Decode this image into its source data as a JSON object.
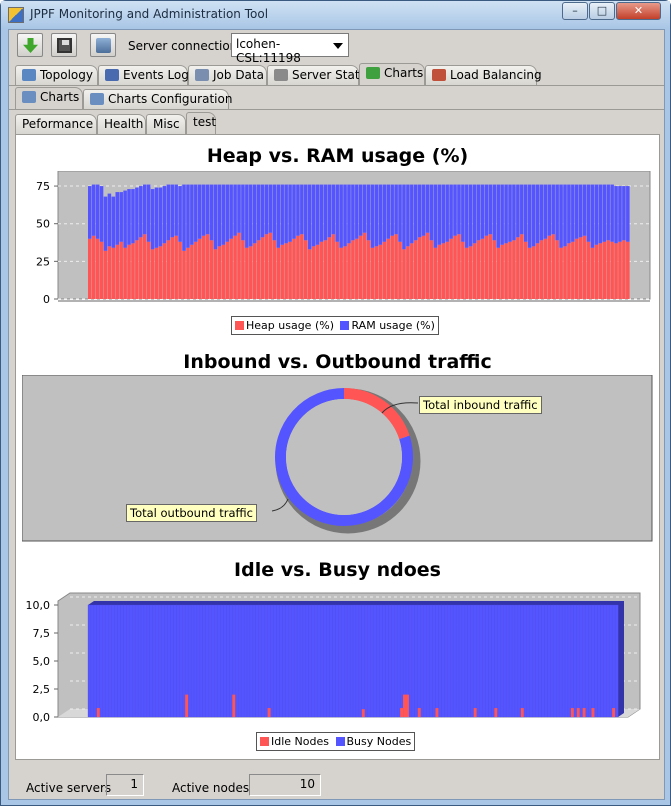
{
  "window": {
    "title": "JPPF Monitoring and Administration Tool",
    "controls": {
      "minimize": "–",
      "maximize": "□",
      "close": "✕"
    }
  },
  "toolbar": {
    "server_connection_label": "Server connection",
    "server_connection_value": "lcohen-CSL:11198"
  },
  "main_tabs": [
    {
      "label": "Topology",
      "icon": "topology-icon",
      "color": "#5a87c2"
    },
    {
      "label": "Events Log",
      "icon": "events-log-icon",
      "color": "#4a6ab0"
    },
    {
      "label": "Job Data",
      "icon": "job-data-icon",
      "color": "#7a8fb0"
    },
    {
      "label": "Server Stats",
      "icon": "server-stats-icon",
      "color": "#8a8a8a"
    },
    {
      "label": "Charts",
      "icon": "charts-icon",
      "color": "#3fa040",
      "selected": true
    },
    {
      "label": "Load Balancing",
      "icon": "load-balancing-icon",
      "color": "#c0503a"
    }
  ],
  "sub_tabs": [
    {
      "label": "Charts",
      "icon": "charts-icon",
      "selected": true
    },
    {
      "label": "Charts Configuration",
      "icon": "charts-config-icon"
    }
  ],
  "chart_tabs": [
    {
      "label": "Peformance"
    },
    {
      "label": "Health"
    },
    {
      "label": "Misc"
    },
    {
      "label": "test",
      "selected": true
    }
  ],
  "colors": {
    "red": "#ff5555",
    "blue": "#5555ff",
    "plot_bg": "#c0c0c0"
  },
  "chart_data": [
    {
      "type": "bar",
      "stacked": true,
      "title": "Heap vs. RAM usage (%)",
      "xlabel": "",
      "ylabel": "",
      "ylim": [
        0,
        85
      ],
      "yticks": [
        "0",
        "25",
        "50",
        "75"
      ],
      "legend_position": "bottom",
      "series": [
        {
          "name": "Heap usage (%)",
          "color": "#ff5555",
          "values": [
            40,
            42,
            40,
            38,
            32,
            35,
            34,
            36,
            38,
            34,
            36,
            37,
            39,
            41,
            43,
            38,
            33,
            34,
            35,
            37,
            39,
            41,
            42,
            38,
            32,
            34,
            36,
            38,
            40,
            42,
            43,
            39,
            33,
            35,
            36,
            38,
            40,
            42,
            44,
            39,
            34,
            35,
            37,
            39,
            41,
            43,
            44,
            39,
            34,
            36,
            37,
            38,
            40,
            42,
            43,
            39,
            33,
            35,
            36,
            38,
            39,
            41,
            43,
            38,
            34,
            35,
            37,
            39,
            40,
            42,
            44,
            39,
            34,
            35,
            36,
            38,
            40,
            42,
            43,
            38,
            33,
            35,
            37,
            39,
            41,
            42,
            44,
            39,
            34,
            36,
            37,
            38,
            40,
            42,
            43,
            38,
            34,
            35,
            37,
            39,
            40,
            42,
            43,
            39,
            34,
            36,
            37,
            38,
            39,
            41,
            43,
            38,
            34,
            35,
            37,
            39,
            40,
            42,
            43,
            39,
            34,
            35,
            37,
            38,
            40,
            41,
            42,
            38,
            34,
            36,
            37,
            38,
            39,
            38,
            37,
            38,
            39,
            38
          ]
        },
        {
          "name": "RAM usage (%)",
          "color": "#5555ff",
          "values": [
            35,
            34,
            36,
            37,
            36,
            35,
            34,
            35,
            33,
            38,
            37,
            36,
            35,
            34,
            33,
            38,
            40,
            40,
            39,
            38,
            37,
            35,
            34,
            37,
            44,
            42,
            40,
            38,
            36,
            34,
            33,
            37,
            43,
            41,
            40,
            38,
            36,
            34,
            32,
            37,
            42,
            41,
            39,
            37,
            35,
            33,
            32,
            37,
            42,
            40,
            39,
            38,
            36,
            34,
            33,
            37,
            43,
            41,
            40,
            38,
            37,
            35,
            33,
            38,
            42,
            41,
            39,
            37,
            36,
            34,
            32,
            37,
            42,
            41,
            40,
            38,
            36,
            34,
            33,
            38,
            43,
            41,
            39,
            37,
            35,
            34,
            32,
            37,
            42,
            40,
            39,
            38,
            36,
            34,
            33,
            38,
            42,
            41,
            39,
            37,
            36,
            34,
            33,
            37,
            42,
            40,
            39,
            38,
            37,
            35,
            33,
            38,
            42,
            41,
            39,
            37,
            36,
            34,
            33,
            37,
            42,
            41,
            39,
            38,
            36,
            35,
            34,
            38,
            42,
            40,
            39,
            38,
            37,
            38,
            38,
            37,
            36,
            37
          ]
        }
      ]
    },
    {
      "type": "pie",
      "donut": true,
      "title": "Inbound vs. Outbound traffic",
      "slices": [
        {
          "name": "Total inbound traffic",
          "value": 20,
          "color": "#ff5555"
        },
        {
          "name": "Total outbound traffic",
          "value": 80,
          "color": "#5555ff"
        }
      ]
    },
    {
      "type": "bar",
      "stacked": true,
      "three_d": true,
      "title": "Idle vs. Busy ndoes",
      "ylim": [
        0,
        10
      ],
      "yticks": [
        "0,0",
        "2,5",
        "5,0",
        "7,5",
        "10,0"
      ],
      "legend_position": "bottom",
      "series": [
        {
          "name": "Idle Nodes",
          "color": "#ff5555",
          "spikes": [
            [
              3,
              0.8
            ],
            [
              33,
              2.0
            ],
            [
              49,
              2.0
            ],
            [
              61,
              0.8
            ],
            [
              93,
              0.7
            ],
            [
              106,
              0.8
            ],
            [
              107,
              2.0
            ],
            [
              108,
              2.0
            ],
            [
              112,
              0.8
            ],
            [
              118,
              0.8
            ],
            [
              131,
              0.8
            ],
            [
              138,
              0.8
            ],
            [
              147,
              0.8
            ],
            [
              164,
              0.8
            ],
            [
              166,
              0.8
            ],
            [
              168,
              0.8
            ],
            [
              171,
              0.8
            ],
            [
              178,
              0.8
            ]
          ]
        },
        {
          "name": "Busy Nodes",
          "color": "#5555ff",
          "bars": 180,
          "value": 10
        }
      ]
    }
  ],
  "status": {
    "active_servers_label": "Active servers",
    "active_servers_value": "1",
    "active_nodes_label": "Active nodes",
    "active_nodes_value": "10"
  }
}
